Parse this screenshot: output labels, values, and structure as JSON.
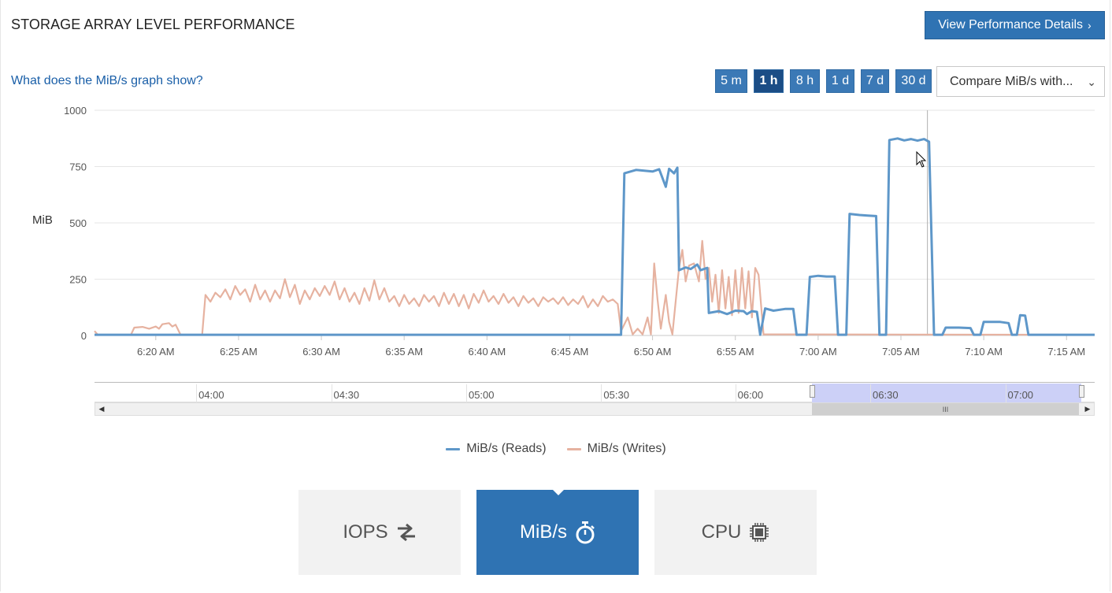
{
  "header": {
    "title": "STORAGE ARRAY LEVEL PERFORMANCE",
    "details_button": "View Performance Details",
    "details_chevron": "›"
  },
  "toolbar": {
    "help_link": "What does the MiB/s graph show?",
    "ranges": [
      {
        "label": "5 m",
        "active": false
      },
      {
        "label": "1 h",
        "active": true
      },
      {
        "label": "8 h",
        "active": false
      },
      {
        "label": "1 d",
        "active": false
      },
      {
        "label": "7 d",
        "active": false
      },
      {
        "label": "30 d",
        "active": false
      }
    ],
    "compare_select": "Compare MiB/s with...",
    "compare_caret": "⌄"
  },
  "colors": {
    "reads": "#5e97c9",
    "writes": "#e6b2a0",
    "accent": "#2f73b3"
  },
  "chart_data": {
    "type": "line",
    "ylabel": "MiB",
    "ylim": [
      0,
      1000
    ],
    "yticks": [
      0,
      250,
      500,
      750,
      1000
    ],
    "xlim_minutes": [
      16.3,
      76.7
    ],
    "xticks": [
      {
        "min": 20,
        "label": "6:20 AM"
      },
      {
        "min": 25,
        "label": "6:25 AM"
      },
      {
        "min": 30,
        "label": "6:30 AM"
      },
      {
        "min": 35,
        "label": "6:35 AM"
      },
      {
        "min": 40,
        "label": "6:40 AM"
      },
      {
        "min": 45,
        "label": "6:45 AM"
      },
      {
        "min": 50,
        "label": "6:50 AM"
      },
      {
        "min": 55,
        "label": "6:55 AM"
      },
      {
        "min": 60,
        "label": "7:00 AM"
      },
      {
        "min": 65,
        "label": "7:05 AM"
      },
      {
        "min": 70,
        "label": "7:10 AM"
      },
      {
        "min": 75,
        "label": "7:15 AM"
      }
    ],
    "crosshair_min": 66.6,
    "series": [
      {
        "name": "MiB/s (Reads)",
        "points": [
          [
            16.3,
            3
          ],
          [
            48.1,
            3
          ],
          [
            48.3,
            720
          ],
          [
            49.0,
            735
          ],
          [
            50.0,
            728
          ],
          [
            50.4,
            738
          ],
          [
            50.8,
            660
          ],
          [
            51.0,
            740
          ],
          [
            51.3,
            720
          ],
          [
            51.5,
            745
          ],
          [
            51.6,
            290
          ],
          [
            52.0,
            302
          ],
          [
            52.3,
            295
          ],
          [
            52.7,
            315
          ],
          [
            52.9,
            290
          ],
          [
            53.3,
            300
          ],
          [
            53.4,
            100
          ],
          [
            54.0,
            108
          ],
          [
            54.5,
            95
          ],
          [
            55.0,
            110
          ],
          [
            55.5,
            108
          ],
          [
            55.7,
            95
          ],
          [
            56.0,
            108
          ],
          [
            56.3,
            105
          ],
          [
            56.5,
            3
          ],
          [
            56.8,
            120
          ],
          [
            57.3,
            110
          ],
          [
            58.0,
            118
          ],
          [
            58.5,
            118
          ],
          [
            58.7,
            3
          ],
          [
            59.3,
            3
          ],
          [
            59.5,
            260
          ],
          [
            60.0,
            265
          ],
          [
            60.5,
            262
          ],
          [
            61.0,
            262
          ],
          [
            61.2,
            3
          ],
          [
            61.7,
            3
          ],
          [
            61.9,
            540
          ],
          [
            62.5,
            535
          ],
          [
            63.0,
            532
          ],
          [
            63.5,
            530
          ],
          [
            63.7,
            3
          ],
          [
            64.1,
            3
          ],
          [
            64.3,
            868
          ],
          [
            64.8,
            875
          ],
          [
            65.2,
            866
          ],
          [
            65.6,
            872
          ],
          [
            66.0,
            865
          ],
          [
            66.4,
            872
          ],
          [
            66.7,
            860
          ],
          [
            67.0,
            3
          ],
          [
            67.5,
            3
          ],
          [
            67.7,
            35
          ],
          [
            68.5,
            35
          ],
          [
            69.2,
            33
          ],
          [
            69.4,
            3
          ],
          [
            69.8,
            3
          ],
          [
            70.0,
            60
          ],
          [
            71.0,
            60
          ],
          [
            71.5,
            55
          ],
          [
            71.7,
            3
          ],
          [
            72.0,
            3
          ],
          [
            72.2,
            90
          ],
          [
            72.5,
            88
          ],
          [
            72.7,
            3
          ],
          [
            76.7,
            3
          ]
        ]
      },
      {
        "name": "MiB/s (Writes)",
        "points": [
          [
            16.3,
            20
          ],
          [
            16.5,
            3
          ],
          [
            18.5,
            3
          ],
          [
            18.7,
            35
          ],
          [
            19.2,
            38
          ],
          [
            19.6,
            30
          ],
          [
            20.0,
            40
          ],
          [
            20.2,
            30
          ],
          [
            20.4,
            50
          ],
          [
            20.8,
            55
          ],
          [
            21.0,
            40
          ],
          [
            21.2,
            48
          ],
          [
            21.5,
            3
          ],
          [
            22.8,
            3
          ],
          [
            23.0,
            180
          ],
          [
            23.3,
            150
          ],
          [
            23.6,
            190
          ],
          [
            23.9,
            170
          ],
          [
            24.2,
            205
          ],
          [
            24.5,
            160
          ],
          [
            24.8,
            220
          ],
          [
            25.1,
            180
          ],
          [
            25.4,
            205
          ],
          [
            25.7,
            150
          ],
          [
            26.0,
            225
          ],
          [
            26.3,
            160
          ],
          [
            26.6,
            200
          ],
          [
            26.9,
            150
          ],
          [
            27.2,
            200
          ],
          [
            27.5,
            165
          ],
          [
            27.8,
            250
          ],
          [
            28.1,
            170
          ],
          [
            28.4,
            225
          ],
          [
            28.7,
            140
          ],
          [
            29.0,
            200
          ],
          [
            29.3,
            160
          ],
          [
            29.6,
            210
          ],
          [
            29.9,
            175
          ],
          [
            30.2,
            220
          ],
          [
            30.5,
            180
          ],
          [
            30.8,
            240
          ],
          [
            31.1,
            160
          ],
          [
            31.4,
            210
          ],
          [
            31.7,
            150
          ],
          [
            32.0,
            190
          ],
          [
            32.3,
            140
          ],
          [
            32.6,
            210
          ],
          [
            32.9,
            155
          ],
          [
            33.2,
            245
          ],
          [
            33.5,
            160
          ],
          [
            33.8,
            210
          ],
          [
            34.1,
            150
          ],
          [
            34.4,
            175
          ],
          [
            34.7,
            130
          ],
          [
            35.0,
            180
          ],
          [
            35.3,
            140
          ],
          [
            35.6,
            165
          ],
          [
            35.9,
            130
          ],
          [
            36.2,
            180
          ],
          [
            36.5,
            150
          ],
          [
            36.8,
            175
          ],
          [
            37.1,
            130
          ],
          [
            37.4,
            190
          ],
          [
            37.7,
            140
          ],
          [
            38.0,
            185
          ],
          [
            38.3,
            130
          ],
          [
            38.6,
            180
          ],
          [
            38.9,
            120
          ],
          [
            39.2,
            185
          ],
          [
            39.5,
            145
          ],
          [
            39.8,
            200
          ],
          [
            40.1,
            150
          ],
          [
            40.4,
            175
          ],
          [
            40.7,
            140
          ],
          [
            41.0,
            185
          ],
          [
            41.3,
            145
          ],
          [
            41.6,
            170
          ],
          [
            41.9,
            130
          ],
          [
            42.2,
            175
          ],
          [
            42.5,
            145
          ],
          [
            42.8,
            165
          ],
          [
            43.1,
            130
          ],
          [
            43.4,
            170
          ],
          [
            43.7,
            150
          ],
          [
            44.0,
            165
          ],
          [
            44.3,
            140
          ],
          [
            44.6,
            170
          ],
          [
            44.9,
            135
          ],
          [
            45.2,
            160
          ],
          [
            45.5,
            140
          ],
          [
            45.8,
            175
          ],
          [
            46.1,
            125
          ],
          [
            46.4,
            160
          ],
          [
            46.7,
            130
          ],
          [
            47.0,
            175
          ],
          [
            47.3,
            150
          ],
          [
            47.6,
            160
          ],
          [
            47.9,
            140
          ],
          [
            48.1,
            20
          ],
          [
            48.5,
            80
          ],
          [
            48.8,
            5
          ],
          [
            49.1,
            30
          ],
          [
            49.4,
            5
          ],
          [
            49.7,
            80
          ],
          [
            49.9,
            5
          ],
          [
            50.1,
            320
          ],
          [
            50.3,
            160
          ],
          [
            50.5,
            30
          ],
          [
            50.8,
            180
          ],
          [
            51.0,
            60
          ],
          [
            51.2,
            5
          ],
          [
            51.6,
            300
          ],
          [
            51.8,
            380
          ],
          [
            52.0,
            240
          ],
          [
            52.2,
            310
          ],
          [
            52.5,
            320
          ],
          [
            52.8,
            240
          ],
          [
            53.0,
            420
          ],
          [
            53.2,
            250
          ],
          [
            53.4,
            300
          ],
          [
            53.6,
            150
          ],
          [
            53.8,
            270
          ],
          [
            54.0,
            100
          ],
          [
            54.2,
            290
          ],
          [
            54.4,
            120
          ],
          [
            54.6,
            260
          ],
          [
            54.8,
            90
          ],
          [
            55.0,
            290
          ],
          [
            55.2,
            100
          ],
          [
            55.4,
            300
          ],
          [
            55.6,
            120
          ],
          [
            55.8,
            285
          ],
          [
            56.0,
            80
          ],
          [
            56.2,
            300
          ],
          [
            56.4,
            270
          ],
          [
            56.7,
            5
          ],
          [
            76.7,
            3
          ]
        ]
      }
    ]
  },
  "navigator": {
    "labels": [
      {
        "pos": 0.104,
        "label": "04:00"
      },
      {
        "pos": 0.239,
        "label": "04:30"
      },
      {
        "pos": 0.374,
        "label": "05:00"
      },
      {
        "pos": 0.509,
        "label": "05:30"
      },
      {
        "pos": 0.643,
        "label": "06:00"
      },
      {
        "pos": 0.778,
        "label": "06:30"
      },
      {
        "pos": 0.913,
        "label": "07:00"
      }
    ],
    "selection_start": 0.717,
    "selection_end": 0.987,
    "thumb_grip": "III",
    "left_arrow": "◀",
    "right_arrow": "▶"
  },
  "legend": {
    "reads": "MiB/s (Reads)",
    "writes": "MiB/s (Writes)"
  },
  "tiles": [
    {
      "label": "IOPS",
      "icon": "swap-arrows-icon",
      "active": false
    },
    {
      "label": "MiB/s",
      "icon": "stopwatch-icon",
      "active": true
    },
    {
      "label": "CPU",
      "icon": "cpu-chip-icon",
      "active": false
    }
  ]
}
